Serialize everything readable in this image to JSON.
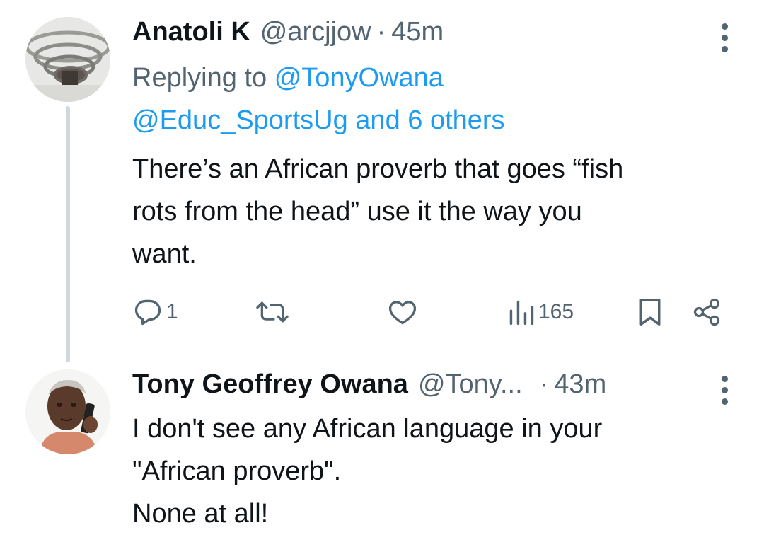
{
  "tweet1": {
    "name": "Anatoli K",
    "handle": "@arcjjow",
    "dot": "·",
    "time": "45m",
    "replying_prefix": "Replying to",
    "replying_user": "@TonyOwana",
    "replying_others_handle": "@Educ_SportsUg",
    "replying_others_rest": "and 6 others",
    "text_lines": [
      "There’s an African proverb that goes “fish",
      "rots from the head” use it the way you",
      "want."
    ],
    "actions": {
      "reply_count": "1",
      "views_count": "165"
    },
    "icons": [
      "avatar-photo",
      "more-vert-icon",
      "reply-icon",
      "retweet-icon",
      "like-icon",
      "views-icon",
      "bookmark-icon",
      "share-icon"
    ]
  },
  "tweet2": {
    "name": "Tony Geoffrey Owana",
    "handle": "@Tony...",
    "dot": "·",
    "time": "43m",
    "text_lines": [
      "I don't see any African language in your",
      "\"African proverb\".",
      "None at all!"
    ]
  },
  "colors": {
    "text": "#0f1419",
    "secondary": "#536471",
    "link": "#1d9bf0",
    "thread_line": "#cfd9de"
  }
}
